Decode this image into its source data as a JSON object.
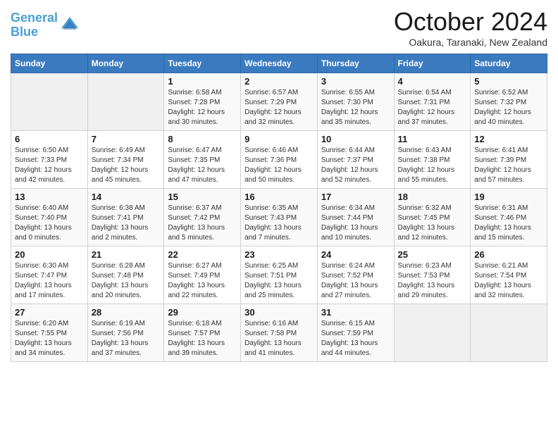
{
  "logo": {
    "line1": "General",
    "line2": "Blue"
  },
  "title": "October 2024",
  "subtitle": "Oakura, Taranaki, New Zealand",
  "weekdays": [
    "Sunday",
    "Monday",
    "Tuesday",
    "Wednesday",
    "Thursday",
    "Friday",
    "Saturday"
  ],
  "weeks": [
    [
      {
        "day": "",
        "info": ""
      },
      {
        "day": "",
        "info": ""
      },
      {
        "day": "1",
        "info": "Sunrise: 6:58 AM\nSunset: 7:28 PM\nDaylight: 12 hours and 30 minutes."
      },
      {
        "day": "2",
        "info": "Sunrise: 6:57 AM\nSunset: 7:29 PM\nDaylight: 12 hours and 32 minutes."
      },
      {
        "day": "3",
        "info": "Sunrise: 6:55 AM\nSunset: 7:30 PM\nDaylight: 12 hours and 35 minutes."
      },
      {
        "day": "4",
        "info": "Sunrise: 6:54 AM\nSunset: 7:31 PM\nDaylight: 12 hours and 37 minutes."
      },
      {
        "day": "5",
        "info": "Sunrise: 6:52 AM\nSunset: 7:32 PM\nDaylight: 12 hours and 40 minutes."
      }
    ],
    [
      {
        "day": "6",
        "info": "Sunrise: 6:50 AM\nSunset: 7:33 PM\nDaylight: 12 hours and 42 minutes."
      },
      {
        "day": "7",
        "info": "Sunrise: 6:49 AM\nSunset: 7:34 PM\nDaylight: 12 hours and 45 minutes."
      },
      {
        "day": "8",
        "info": "Sunrise: 6:47 AM\nSunset: 7:35 PM\nDaylight: 12 hours and 47 minutes."
      },
      {
        "day": "9",
        "info": "Sunrise: 6:46 AM\nSunset: 7:36 PM\nDaylight: 12 hours and 50 minutes."
      },
      {
        "day": "10",
        "info": "Sunrise: 6:44 AM\nSunset: 7:37 PM\nDaylight: 12 hours and 52 minutes."
      },
      {
        "day": "11",
        "info": "Sunrise: 6:43 AM\nSunset: 7:38 PM\nDaylight: 12 hours and 55 minutes."
      },
      {
        "day": "12",
        "info": "Sunrise: 6:41 AM\nSunset: 7:39 PM\nDaylight: 12 hours and 57 minutes."
      }
    ],
    [
      {
        "day": "13",
        "info": "Sunrise: 6:40 AM\nSunset: 7:40 PM\nDaylight: 13 hours and 0 minutes."
      },
      {
        "day": "14",
        "info": "Sunrise: 6:38 AM\nSunset: 7:41 PM\nDaylight: 13 hours and 2 minutes."
      },
      {
        "day": "15",
        "info": "Sunrise: 6:37 AM\nSunset: 7:42 PM\nDaylight: 13 hours and 5 minutes."
      },
      {
        "day": "16",
        "info": "Sunrise: 6:35 AM\nSunset: 7:43 PM\nDaylight: 13 hours and 7 minutes."
      },
      {
        "day": "17",
        "info": "Sunrise: 6:34 AM\nSunset: 7:44 PM\nDaylight: 13 hours and 10 minutes."
      },
      {
        "day": "18",
        "info": "Sunrise: 6:32 AM\nSunset: 7:45 PM\nDaylight: 13 hours and 12 minutes."
      },
      {
        "day": "19",
        "info": "Sunrise: 6:31 AM\nSunset: 7:46 PM\nDaylight: 13 hours and 15 minutes."
      }
    ],
    [
      {
        "day": "20",
        "info": "Sunrise: 6:30 AM\nSunset: 7:47 PM\nDaylight: 13 hours and 17 minutes."
      },
      {
        "day": "21",
        "info": "Sunrise: 6:28 AM\nSunset: 7:48 PM\nDaylight: 13 hours and 20 minutes."
      },
      {
        "day": "22",
        "info": "Sunrise: 6:27 AM\nSunset: 7:49 PM\nDaylight: 13 hours and 22 minutes."
      },
      {
        "day": "23",
        "info": "Sunrise: 6:25 AM\nSunset: 7:51 PM\nDaylight: 13 hours and 25 minutes."
      },
      {
        "day": "24",
        "info": "Sunrise: 6:24 AM\nSunset: 7:52 PM\nDaylight: 13 hours and 27 minutes."
      },
      {
        "day": "25",
        "info": "Sunrise: 6:23 AM\nSunset: 7:53 PM\nDaylight: 13 hours and 29 minutes."
      },
      {
        "day": "26",
        "info": "Sunrise: 6:21 AM\nSunset: 7:54 PM\nDaylight: 13 hours and 32 minutes."
      }
    ],
    [
      {
        "day": "27",
        "info": "Sunrise: 6:20 AM\nSunset: 7:55 PM\nDaylight: 13 hours and 34 minutes."
      },
      {
        "day": "28",
        "info": "Sunrise: 6:19 AM\nSunset: 7:56 PM\nDaylight: 13 hours and 37 minutes."
      },
      {
        "day": "29",
        "info": "Sunrise: 6:18 AM\nSunset: 7:57 PM\nDaylight: 13 hours and 39 minutes."
      },
      {
        "day": "30",
        "info": "Sunrise: 6:16 AM\nSunset: 7:58 PM\nDaylight: 13 hours and 41 minutes."
      },
      {
        "day": "31",
        "info": "Sunrise: 6:15 AM\nSunset: 7:59 PM\nDaylight: 13 hours and 44 minutes."
      },
      {
        "day": "",
        "info": ""
      },
      {
        "day": "",
        "info": ""
      }
    ]
  ]
}
